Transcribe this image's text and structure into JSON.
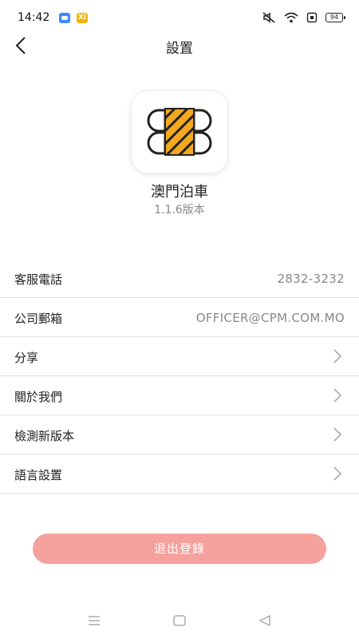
{
  "status_bar": {
    "time": "14:42",
    "notification_badge": "Xi",
    "battery": "94",
    "icons": [
      "app-notification-icon",
      "xi-app-icon",
      "mute-icon",
      "wifi-icon",
      "sim-icon",
      "battery-icon"
    ]
  },
  "navbar": {
    "title": "設置",
    "back_icon": "back-chevron-icon"
  },
  "app": {
    "name": "澳門泊車",
    "version": "1.1.6版本",
    "logo_colors": {
      "primary": "#f4a81d",
      "outline": "#222222"
    }
  },
  "settings": [
    {
      "label": "客服電話",
      "value": "2832-3232",
      "type": "value"
    },
    {
      "label": "公司郵箱",
      "value": "OFFICER@CPM.COM.MO",
      "type": "value"
    },
    {
      "label": "分享",
      "type": "link"
    },
    {
      "label": "關於我們",
      "type": "link"
    },
    {
      "label": "檢測新版本",
      "type": "link"
    },
    {
      "label": "語言設置",
      "type": "link"
    }
  ],
  "logout": {
    "label": "退出登錄",
    "color": "#f5a19d"
  },
  "system_nav": [
    "menu-icon",
    "home-icon",
    "back-icon"
  ]
}
